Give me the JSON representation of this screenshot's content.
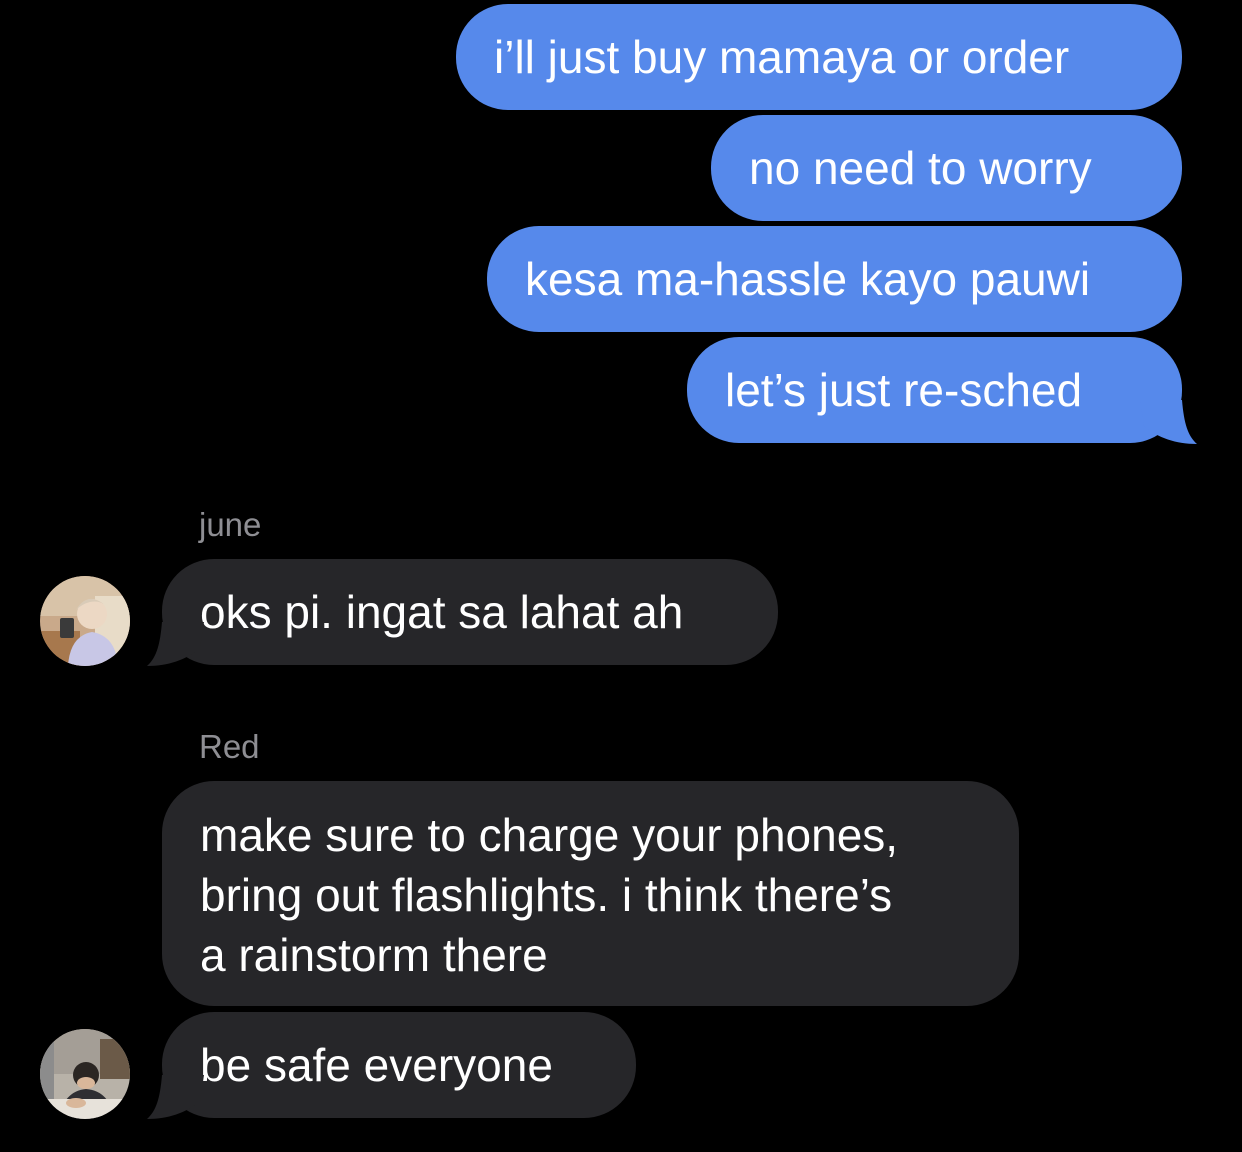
{
  "sent_messages": [
    {
      "text": "i’ll just buy mamaya or order"
    },
    {
      "text": "no need to worry"
    },
    {
      "text": "kesa ma-hassle kayo pauwi"
    },
    {
      "text": "let’s just re-sched"
    }
  ],
  "received_groups": [
    {
      "sender": "june",
      "avatar_icon": "profile-photo-icon",
      "messages": [
        {
          "text": "oks pi. ingat sa lahat ah"
        }
      ]
    },
    {
      "sender": "Red",
      "avatar_icon": "profile-photo-icon",
      "messages": [
        {
          "lines": [
            "make sure to charge your phones,",
            "bring out flashlights. i think there’s",
            "a rainstorm there"
          ]
        },
        {
          "text": "be safe everyone"
        }
      ]
    }
  ],
  "colors": {
    "background": "#000000",
    "sent_bubble": "#5689eb",
    "received_bubble": "#262629",
    "sender_name": "#8e8e93",
    "text": "#ffffff"
  }
}
